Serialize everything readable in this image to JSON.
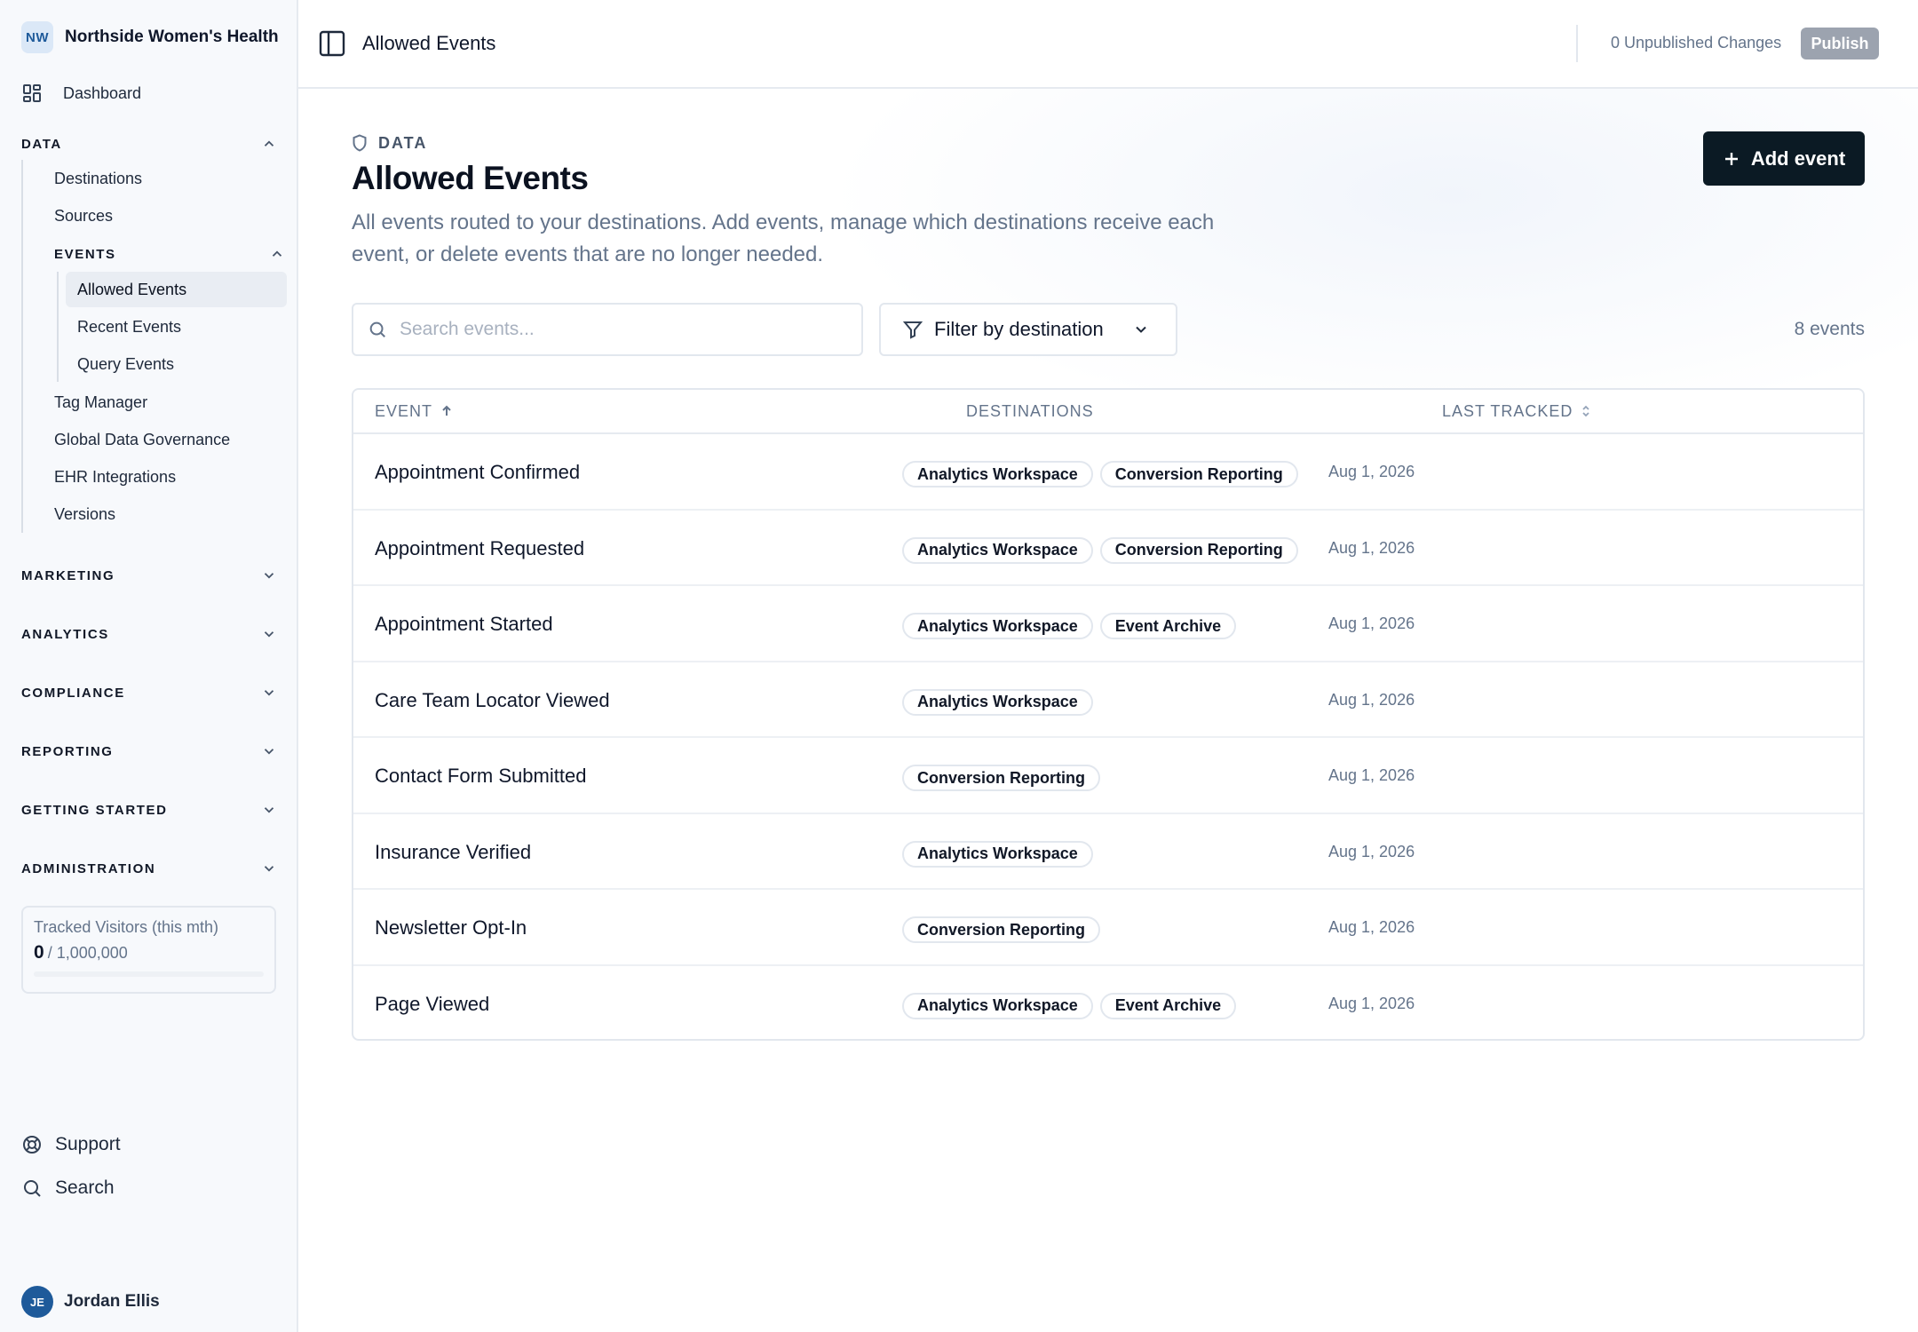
{
  "org": {
    "initials": "NW",
    "name": "Northside Women's Health"
  },
  "sidebar": {
    "dashboard_label": "Dashboard",
    "data_section": {
      "label": "DATA",
      "items": [
        {
          "label": "Destinations"
        },
        {
          "label": "Sources"
        }
      ],
      "events_group": {
        "label": "EVENTS",
        "items": [
          {
            "label": "Allowed Events",
            "active": true
          },
          {
            "label": "Recent Events"
          },
          {
            "label": "Query Events"
          }
        ]
      },
      "more_items": [
        {
          "label": "Tag Manager"
        },
        {
          "label": "Global Data Governance"
        },
        {
          "label": "EHR Integrations"
        },
        {
          "label": "Versions"
        }
      ]
    },
    "sections": [
      {
        "label": "MARKETING"
      },
      {
        "label": "ANALYTICS"
      },
      {
        "label": "COMPLIANCE"
      },
      {
        "label": "REPORTING"
      },
      {
        "label": "GETTING STARTED"
      },
      {
        "label": "ADMINISTRATION"
      }
    ],
    "visitors": {
      "label": "Tracked Visitors (this mth)",
      "count": "0",
      "limit": "/ 1,000,000",
      "progress": 0
    },
    "support_label": "Support",
    "search_label": "Search",
    "user": {
      "initials": "JE",
      "name": "Jordan Ellis"
    }
  },
  "topbar": {
    "title": "Allowed Events",
    "unpublished": "0 Unpublished Changes",
    "publish_label": "Publish"
  },
  "page": {
    "eyebrow": "DATA",
    "title": "Allowed Events",
    "description": "All events routed to your destinations. Add events, manage which destinations receive each event, or delete events that are no longer needed.",
    "add_label": "Add event",
    "search_placeholder": "Search events...",
    "filter_label": "Filter by destination",
    "count_text": "8 events"
  },
  "table": {
    "columns": {
      "event": "EVENT",
      "destinations": "DESTINATIONS",
      "last_tracked": "LAST TRACKED"
    },
    "rows": [
      {
        "event": "Appointment Confirmed",
        "destinations": [
          "Analytics Workspace",
          "Conversion Reporting"
        ],
        "last_tracked": "Aug 1, 2026"
      },
      {
        "event": "Appointment Requested",
        "destinations": [
          "Analytics Workspace",
          "Conversion Reporting"
        ],
        "last_tracked": "Aug 1, 2026"
      },
      {
        "event": "Appointment Started",
        "destinations": [
          "Analytics Workspace",
          "Event Archive"
        ],
        "last_tracked": "Aug 1, 2026"
      },
      {
        "event": "Care Team Locator Viewed",
        "destinations": [
          "Analytics Workspace"
        ],
        "last_tracked": "Aug 1, 2026"
      },
      {
        "event": "Contact Form Submitted",
        "destinations": [
          "Conversion Reporting"
        ],
        "last_tracked": "Aug 1, 2026"
      },
      {
        "event": "Insurance Verified",
        "destinations": [
          "Analytics Workspace"
        ],
        "last_tracked": "Aug 1, 2026"
      },
      {
        "event": "Newsletter Opt-In",
        "destinations": [
          "Conversion Reporting"
        ],
        "last_tracked": "Aug 1, 2026"
      },
      {
        "event": "Page Viewed",
        "destinations": [
          "Analytics Workspace",
          "Event Archive"
        ],
        "last_tracked": "Aug 1, 2026"
      }
    ]
  },
  "colors": {
    "primary_button": "#0b1a24",
    "publish_disabled": "#9ca3af",
    "badge_bg": "#dbe8f7",
    "avatar_bg": "#1e5a9a"
  }
}
